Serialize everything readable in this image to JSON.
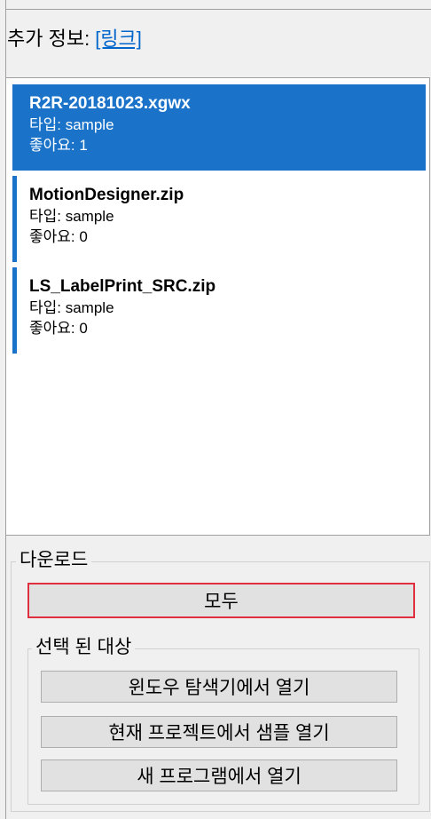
{
  "info": {
    "label": "추가 정보:",
    "link": "[링크]"
  },
  "samples": [
    {
      "name": "R2R-20181023.xgwx",
      "type": "타입: sample",
      "likes": "좋아요: 1",
      "selected": true
    },
    {
      "name": "MotionDesigner.zip",
      "type": "타입: sample",
      "likes": "좋아요: 0",
      "selected": false
    },
    {
      "name": "LS_LabelPrint_SRC.zip",
      "type": "타입: sample",
      "likes": "좋아요: 0",
      "selected": false
    }
  ],
  "download": {
    "group_label": "다운로드",
    "all_button": "모두",
    "selected_group_label": "선택 된 대상",
    "open_explorer_button": "윈도우 탐색기에서 열기",
    "open_in_project_button": "현재 프로젝트에서 샘플 열기",
    "open_new_program_button": "새 프로그램에서 열기"
  },
  "colors": {
    "accent": "#1a73c9",
    "focus_border": "#e03040",
    "link": "#0066cc"
  }
}
